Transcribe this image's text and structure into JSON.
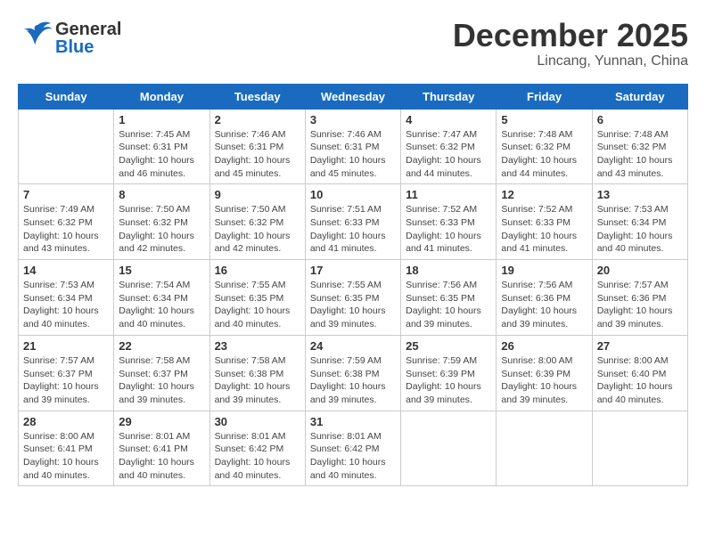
{
  "header": {
    "logo_general": "General",
    "logo_blue": "Blue",
    "month": "December 2025",
    "location": "Lincang, Yunnan, China"
  },
  "days_of_week": [
    "Sunday",
    "Monday",
    "Tuesday",
    "Wednesday",
    "Thursday",
    "Friday",
    "Saturday"
  ],
  "weeks": [
    [
      {
        "day": "",
        "details": ""
      },
      {
        "day": "1",
        "details": "Sunrise: 7:45 AM\nSunset: 6:31 PM\nDaylight: 10 hours\nand 46 minutes."
      },
      {
        "day": "2",
        "details": "Sunrise: 7:46 AM\nSunset: 6:31 PM\nDaylight: 10 hours\nand 45 minutes."
      },
      {
        "day": "3",
        "details": "Sunrise: 7:46 AM\nSunset: 6:31 PM\nDaylight: 10 hours\nand 45 minutes."
      },
      {
        "day": "4",
        "details": "Sunrise: 7:47 AM\nSunset: 6:32 PM\nDaylight: 10 hours\nand 44 minutes."
      },
      {
        "day": "5",
        "details": "Sunrise: 7:48 AM\nSunset: 6:32 PM\nDaylight: 10 hours\nand 44 minutes."
      },
      {
        "day": "6",
        "details": "Sunrise: 7:48 AM\nSunset: 6:32 PM\nDaylight: 10 hours\nand 43 minutes."
      }
    ],
    [
      {
        "day": "7",
        "details": "Sunrise: 7:49 AM\nSunset: 6:32 PM\nDaylight: 10 hours\nand 43 minutes."
      },
      {
        "day": "8",
        "details": "Sunrise: 7:50 AM\nSunset: 6:32 PM\nDaylight: 10 hours\nand 42 minutes."
      },
      {
        "day": "9",
        "details": "Sunrise: 7:50 AM\nSunset: 6:32 PM\nDaylight: 10 hours\nand 42 minutes."
      },
      {
        "day": "10",
        "details": "Sunrise: 7:51 AM\nSunset: 6:33 PM\nDaylight: 10 hours\nand 41 minutes."
      },
      {
        "day": "11",
        "details": "Sunrise: 7:52 AM\nSunset: 6:33 PM\nDaylight: 10 hours\nand 41 minutes."
      },
      {
        "day": "12",
        "details": "Sunrise: 7:52 AM\nSunset: 6:33 PM\nDaylight: 10 hours\nand 41 minutes."
      },
      {
        "day": "13",
        "details": "Sunrise: 7:53 AM\nSunset: 6:34 PM\nDaylight: 10 hours\nand 40 minutes."
      }
    ],
    [
      {
        "day": "14",
        "details": "Sunrise: 7:53 AM\nSunset: 6:34 PM\nDaylight: 10 hours\nand 40 minutes."
      },
      {
        "day": "15",
        "details": "Sunrise: 7:54 AM\nSunset: 6:34 PM\nDaylight: 10 hours\nand 40 minutes."
      },
      {
        "day": "16",
        "details": "Sunrise: 7:55 AM\nSunset: 6:35 PM\nDaylight: 10 hours\nand 40 minutes."
      },
      {
        "day": "17",
        "details": "Sunrise: 7:55 AM\nSunset: 6:35 PM\nDaylight: 10 hours\nand 39 minutes."
      },
      {
        "day": "18",
        "details": "Sunrise: 7:56 AM\nSunset: 6:35 PM\nDaylight: 10 hours\nand 39 minutes."
      },
      {
        "day": "19",
        "details": "Sunrise: 7:56 AM\nSunset: 6:36 PM\nDaylight: 10 hours\nand 39 minutes."
      },
      {
        "day": "20",
        "details": "Sunrise: 7:57 AM\nSunset: 6:36 PM\nDaylight: 10 hours\nand 39 minutes."
      }
    ],
    [
      {
        "day": "21",
        "details": "Sunrise: 7:57 AM\nSunset: 6:37 PM\nDaylight: 10 hours\nand 39 minutes."
      },
      {
        "day": "22",
        "details": "Sunrise: 7:58 AM\nSunset: 6:37 PM\nDaylight: 10 hours\nand 39 minutes."
      },
      {
        "day": "23",
        "details": "Sunrise: 7:58 AM\nSunset: 6:38 PM\nDaylight: 10 hours\nand 39 minutes."
      },
      {
        "day": "24",
        "details": "Sunrise: 7:59 AM\nSunset: 6:38 PM\nDaylight: 10 hours\nand 39 minutes."
      },
      {
        "day": "25",
        "details": "Sunrise: 7:59 AM\nSunset: 6:39 PM\nDaylight: 10 hours\nand 39 minutes."
      },
      {
        "day": "26",
        "details": "Sunrise: 8:00 AM\nSunset: 6:39 PM\nDaylight: 10 hours\nand 39 minutes."
      },
      {
        "day": "27",
        "details": "Sunrise: 8:00 AM\nSunset: 6:40 PM\nDaylight: 10 hours\nand 40 minutes."
      }
    ],
    [
      {
        "day": "28",
        "details": "Sunrise: 8:00 AM\nSunset: 6:41 PM\nDaylight: 10 hours\nand 40 minutes."
      },
      {
        "day": "29",
        "details": "Sunrise: 8:01 AM\nSunset: 6:41 PM\nDaylight: 10 hours\nand 40 minutes."
      },
      {
        "day": "30",
        "details": "Sunrise: 8:01 AM\nSunset: 6:42 PM\nDaylight: 10 hours\nand 40 minutes."
      },
      {
        "day": "31",
        "details": "Sunrise: 8:01 AM\nSunset: 6:42 PM\nDaylight: 10 hours\nand 40 minutes."
      },
      {
        "day": "",
        "details": ""
      },
      {
        "day": "",
        "details": ""
      },
      {
        "day": "",
        "details": ""
      }
    ]
  ]
}
